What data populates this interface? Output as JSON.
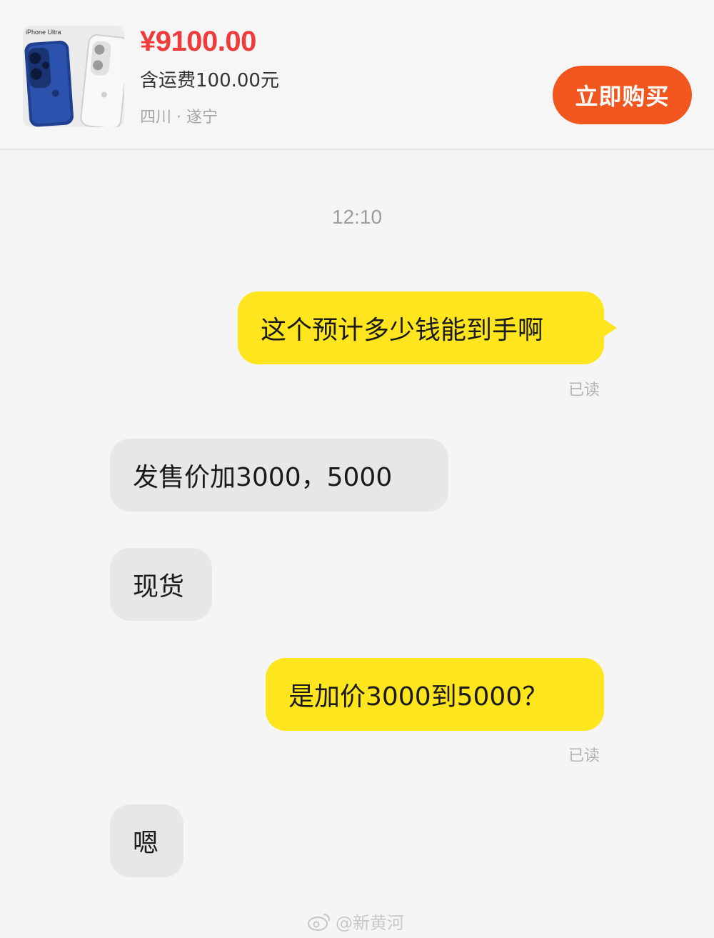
{
  "product": {
    "thumb_label": "iPhone Ultra",
    "price": "¥9100.00",
    "shipping": "含运费100.00元",
    "location": "四川 · 遂宁",
    "buy_label": "立即购买",
    "colors": {
      "price": "#ef3b3b",
      "buy_button": "#f2561f"
    }
  },
  "chat": {
    "timestamp": "12:10",
    "messages": [
      {
        "side": "out",
        "text": "这个预计多少钱能到手啊",
        "status": "已读"
      },
      {
        "side": "in",
        "text": "发售价加3000，5000"
      },
      {
        "side": "in",
        "text": "现货"
      },
      {
        "side": "out",
        "text": "是加价3000到5000？",
        "status": "已读"
      },
      {
        "side": "in",
        "text": "嗯"
      }
    ],
    "colors": {
      "outgoing": "#fee51e",
      "incoming": "#e7e7e7"
    }
  },
  "watermark": {
    "icon": "weibo-icon",
    "text": "@新黄河"
  }
}
